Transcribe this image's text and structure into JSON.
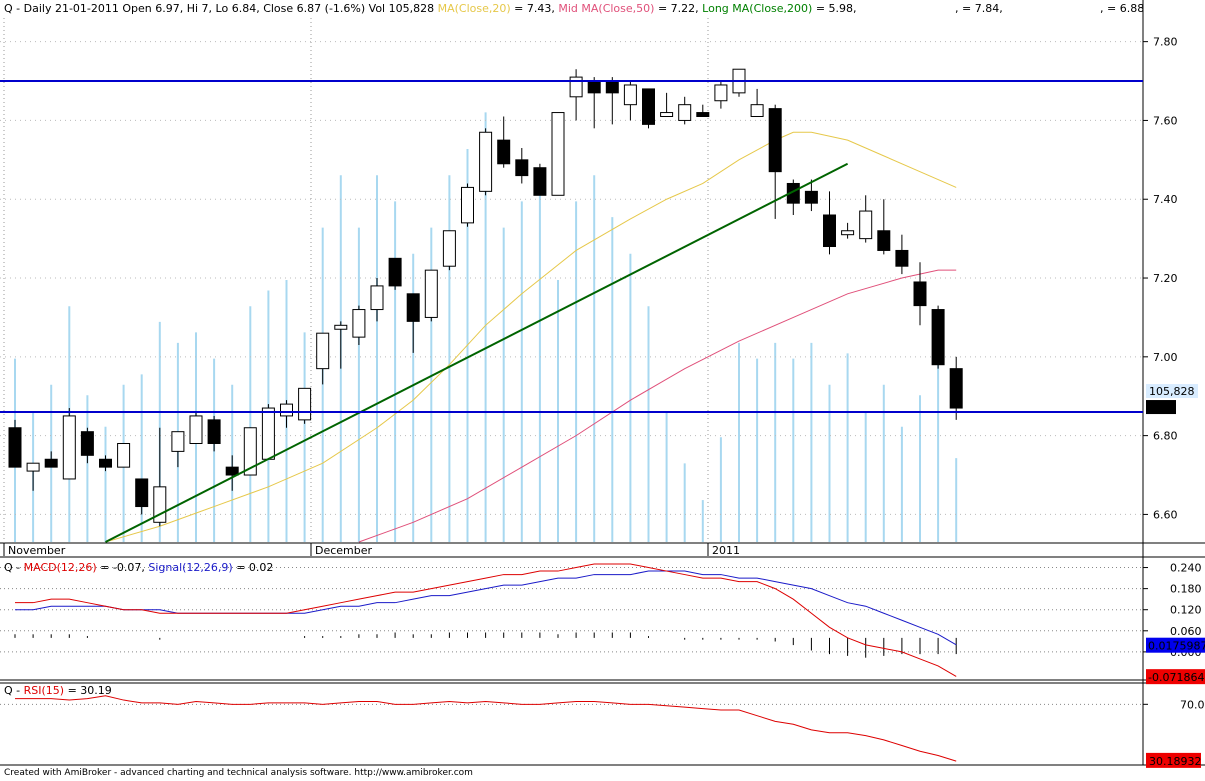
{
  "header": {
    "prefix": "Q - Daily 21-01-2011 Open 6.97, Hi 7, Lo 6.84, Close 6.87 (-1.6%) Vol 105,828",
    "ma20_label": "MA(Close,20)",
    "ma20_value": " = 7.43,",
    "ma50_label": "Mid MA(Close,50)",
    "ma50_value": " = 7.22,",
    "ma200_label": "Long MA(Close,200)",
    "ma200_value": " = 5.98,",
    "extra1": ", = 7.84,",
    "extra2": ", = 6.88"
  },
  "macd_header": {
    "prefix": "Q - ",
    "macd_label": "MACD(12,26)",
    "macd_value": " = -0.07, ",
    "signal_label": "Signal(12,26,9)",
    "signal_value": " = 0.02"
  },
  "rsi_header": {
    "prefix": "Q - ",
    "rsi_label": "RSI(15)",
    "rsi_value": " = 30.19"
  },
  "footer": "Created with AmiBroker - advanced charting and technical analysis software. http://www.amibroker.com",
  "price_axis": {
    "ticks": [
      "7.80",
      "7.60",
      "7.40",
      "7.20",
      "7.00",
      "6.80",
      "6.60"
    ],
    "volume_badge": "105,828",
    "close_badge": "6.87"
  },
  "macd_axis": {
    "ticks": [
      "0.240",
      "0.180",
      "0.120",
      "0.060",
      "0.000"
    ],
    "signal_badge": "0.0175987",
    "macd_badge": "-0.071864"
  },
  "rsi_axis": {
    "ticks": [
      "70.0"
    ],
    "rsi_badge": "30.18932"
  },
  "colors": {
    "up": "#ffffff",
    "down": "#000000",
    "volume": "#a8d8f0",
    "ma20": "#e6c84a",
    "ma50": "#e0507a",
    "trend": "#006400",
    "hline": "#0000cc",
    "macd": "#dd0000",
    "signal": "#1a1ac8"
  },
  "chart_data": [
    {
      "type": "candlestick",
      "title": "Q - Daily",
      "x_labels": [
        "November",
        "December",
        "2011"
      ],
      "ylim": [
        6.53,
        7.86
      ],
      "candles": [
        {
          "o": 6.82,
          "h": 6.84,
          "l": 6.72,
          "c": 6.72
        },
        {
          "o": 6.71,
          "h": 6.73,
          "l": 6.66,
          "c": 6.73
        },
        {
          "o": 6.74,
          "h": 6.76,
          "l": 6.72,
          "c": 6.72
        },
        {
          "o": 6.69,
          "h": 6.87,
          "l": 6.69,
          "c": 6.85
        },
        {
          "o": 6.81,
          "h": 6.82,
          "l": 6.73,
          "c": 6.75
        },
        {
          "o": 6.74,
          "h": 6.75,
          "l": 6.71,
          "c": 6.72
        },
        {
          "o": 6.72,
          "h": 6.78,
          "l": 6.72,
          "c": 6.78
        },
        {
          "o": 6.69,
          "h": 6.69,
          "l": 6.6,
          "c": 6.62
        },
        {
          "o": 6.58,
          "h": 6.82,
          "l": 6.57,
          "c": 6.67
        },
        {
          "o": 6.76,
          "h": 6.81,
          "l": 6.72,
          "c": 6.81
        },
        {
          "o": 6.78,
          "h": 6.86,
          "l": 6.78,
          "c": 6.85
        },
        {
          "o": 6.84,
          "h": 6.85,
          "l": 6.76,
          "c": 6.78
        },
        {
          "o": 6.72,
          "h": 6.75,
          "l": 6.66,
          "c": 6.7
        },
        {
          "o": 6.7,
          "h": 6.82,
          "l": 6.7,
          "c": 6.82
        },
        {
          "o": 6.74,
          "h": 6.88,
          "l": 6.74,
          "c": 6.87
        },
        {
          "o": 6.85,
          "h": 6.89,
          "l": 6.82,
          "c": 6.88
        },
        {
          "o": 6.84,
          "h": 6.92,
          "l": 6.83,
          "c": 6.92
        },
        {
          "o": 6.97,
          "h": 7.06,
          "l": 6.93,
          "c": 7.06
        },
        {
          "o": 7.07,
          "h": 7.09,
          "l": 6.97,
          "c": 7.08
        },
        {
          "o": 7.05,
          "h": 7.13,
          "l": 7.03,
          "c": 7.12
        },
        {
          "o": 7.12,
          "h": 7.2,
          "l": 7.09,
          "c": 7.18
        },
        {
          "o": 7.25,
          "h": 7.25,
          "l": 7.17,
          "c": 7.18
        },
        {
          "o": 7.16,
          "h": 7.16,
          "l": 7.01,
          "c": 7.09
        },
        {
          "o": 7.1,
          "h": 7.22,
          "l": 7.09,
          "c": 7.22
        },
        {
          "o": 7.23,
          "h": 7.32,
          "l": 7.22,
          "c": 7.32
        },
        {
          "o": 7.34,
          "h": 7.44,
          "l": 7.33,
          "c": 7.43
        },
        {
          "o": 7.42,
          "h": 7.58,
          "l": 7.41,
          "c": 7.57
        },
        {
          "o": 7.55,
          "h": 7.61,
          "l": 7.48,
          "c": 7.49
        },
        {
          "o": 7.5,
          "h": 7.53,
          "l": 7.44,
          "c": 7.46
        },
        {
          "o": 7.48,
          "h": 7.49,
          "l": 7.41,
          "c": 7.41
        },
        {
          "o": 7.41,
          "h": 7.62,
          "l": 7.41,
          "c": 7.62
        },
        {
          "o": 7.66,
          "h": 7.73,
          "l": 7.6,
          "c": 7.71
        },
        {
          "o": 7.7,
          "h": 7.71,
          "l": 7.58,
          "c": 7.67
        },
        {
          "o": 7.7,
          "h": 7.71,
          "l": 7.59,
          "c": 7.67
        },
        {
          "o": 7.64,
          "h": 7.7,
          "l": 7.6,
          "c": 7.69
        },
        {
          "o": 7.68,
          "h": 7.68,
          "l": 7.58,
          "c": 7.59
        },
        {
          "o": 7.61,
          "h": 7.67,
          "l": 7.61,
          "c": 7.62
        },
        {
          "o": 7.6,
          "h": 7.66,
          "l": 7.59,
          "c": 7.64
        },
        {
          "o": 7.62,
          "h": 7.64,
          "l": 7.61,
          "c": 7.61
        },
        {
          "o": 7.65,
          "h": 7.7,
          "l": 7.63,
          "c": 7.69
        },
        {
          "o": 7.67,
          "h": 7.73,
          "l": 7.66,
          "c": 7.73
        },
        {
          "o": 7.61,
          "h": 7.68,
          "l": 7.61,
          "c": 7.64
        },
        {
          "o": 7.63,
          "h": 7.64,
          "l": 7.35,
          "c": 7.47
        },
        {
          "o": 7.44,
          "h": 7.45,
          "l": 7.36,
          "c": 7.39
        },
        {
          "o": 7.42,
          "h": 7.45,
          "l": 7.37,
          "c": 7.39
        },
        {
          "o": 7.36,
          "h": 7.42,
          "l": 7.26,
          "c": 7.28
        },
        {
          "o": 7.31,
          "h": 7.34,
          "l": 7.3,
          "c": 7.32
        },
        {
          "o": 7.3,
          "h": 7.41,
          "l": 7.29,
          "c": 7.37
        },
        {
          "o": 7.32,
          "h": 7.4,
          "l": 7.26,
          "c": 7.27
        },
        {
          "o": 7.27,
          "h": 7.31,
          "l": 7.21,
          "c": 7.23
        },
        {
          "o": 7.19,
          "h": 7.24,
          "l": 7.08,
          "c": 7.13
        },
        {
          "o": 7.12,
          "h": 7.13,
          "l": 6.97,
          "c": 6.98
        },
        {
          "o": 6.97,
          "h": 7.0,
          "l": 6.84,
          "c": 6.87
        }
      ],
      "volume": [
        0.35,
        0.25,
        0.3,
        0.45,
        0.28,
        0.22,
        0.3,
        0.32,
        0.42,
        0.38,
        0.4,
        0.35,
        0.3,
        0.45,
        0.48,
        0.5,
        0.4,
        0.6,
        0.7,
        0.6,
        0.7,
        0.65,
        0.55,
        0.6,
        0.7,
        0.75,
        0.82,
        0.6,
        0.65,
        0.68,
        0.5,
        0.65,
        0.7,
        0.62,
        0.55,
        0.45,
        0.25,
        0.15,
        0.08,
        0.2,
        0.38,
        0.35,
        0.38,
        0.35,
        0.38,
        0.3,
        0.36,
        0.25,
        0.3,
        0.22,
        0.28,
        0.38,
        0.16
      ],
      "ma20": [
        [
          5,
          6.53
        ],
        [
          8,
          6.57
        ],
        [
          11,
          6.62
        ],
        [
          14,
          6.67
        ],
        [
          17,
          6.73
        ],
        [
          20,
          6.82
        ],
        [
          22,
          6.89
        ],
        [
          24,
          6.98
        ],
        [
          26,
          7.08
        ],
        [
          28,
          7.16
        ],
        [
          31,
          7.27
        ],
        [
          34,
          7.35
        ],
        [
          36,
          7.4
        ],
        [
          38,
          7.44
        ],
        [
          40,
          7.5
        ],
        [
          42,
          7.55
        ],
        [
          43,
          7.57
        ],
        [
          44,
          7.57
        ],
        [
          46,
          7.55
        ],
        [
          48,
          7.51
        ],
        [
          50,
          7.47
        ],
        [
          52,
          7.43
        ]
      ],
      "ma50": [
        [
          19,
          6.53
        ],
        [
          22,
          6.58
        ],
        [
          25,
          6.64
        ],
        [
          28,
          6.72
        ],
        [
          31,
          6.8
        ],
        [
          34,
          6.89
        ],
        [
          37,
          6.97
        ],
        [
          40,
          7.04
        ],
        [
          43,
          7.1
        ],
        [
          46,
          7.16
        ],
        [
          49,
          7.2
        ],
        [
          51,
          7.22
        ],
        [
          52,
          7.22
        ]
      ],
      "trendline": [
        [
          5,
          6.53
        ],
        [
          46,
          7.49
        ]
      ],
      "hlines": [
        7.7,
        6.86
      ]
    },
    {
      "type": "line",
      "title": "MACD(12,26) / Signal(12,26,9)",
      "ylim": [
        -0.08,
        0.27
      ],
      "series": [
        {
          "name": "MACD(12,26)",
          "values": [
            0.14,
            0.14,
            0.15,
            0.15,
            0.14,
            0.13,
            0.12,
            0.12,
            0.11,
            0.11,
            0.11,
            0.11,
            0.11,
            0.11,
            0.11,
            0.11,
            0.12,
            0.13,
            0.14,
            0.15,
            0.16,
            0.17,
            0.17,
            0.18,
            0.19,
            0.2,
            0.21,
            0.22,
            0.22,
            0.23,
            0.23,
            0.24,
            0.25,
            0.25,
            0.25,
            0.24,
            0.23,
            0.22,
            0.21,
            0.21,
            0.2,
            0.2,
            0.18,
            0.15,
            0.11,
            0.07,
            0.04,
            0.02,
            0.01,
            0.0,
            -0.02,
            -0.04,
            -0.07
          ]
        },
        {
          "name": "Signal(12,26,9)",
          "values": [
            0.12,
            0.12,
            0.13,
            0.13,
            0.13,
            0.13,
            0.12,
            0.12,
            0.12,
            0.11,
            0.11,
            0.11,
            0.11,
            0.11,
            0.11,
            0.11,
            0.11,
            0.12,
            0.13,
            0.13,
            0.14,
            0.14,
            0.15,
            0.16,
            0.16,
            0.17,
            0.18,
            0.19,
            0.19,
            0.2,
            0.21,
            0.21,
            0.22,
            0.22,
            0.22,
            0.23,
            0.23,
            0.23,
            0.22,
            0.22,
            0.21,
            0.21,
            0.2,
            0.19,
            0.18,
            0.16,
            0.14,
            0.13,
            0.11,
            0.09,
            0.07,
            0.05,
            0.02
          ]
        }
      ]
    },
    {
      "type": "line",
      "title": "RSI(15)",
      "ylim": [
        28,
        85
      ],
      "series": [
        {
          "name": "RSI(15)",
          "values": [
            74,
            74,
            74,
            73,
            74,
            76,
            73,
            71,
            71,
            70,
            72,
            71,
            70,
            70,
            71,
            71,
            71,
            70,
            71,
            72,
            72,
            70,
            70,
            71,
            72,
            71,
            72,
            71,
            70,
            70,
            71,
            72,
            72,
            71,
            70,
            70,
            69,
            68,
            67,
            66,
            66,
            62,
            58,
            56,
            52,
            50,
            50,
            48,
            45,
            41,
            37,
            34,
            30
          ]
        }
      ]
    }
  ]
}
